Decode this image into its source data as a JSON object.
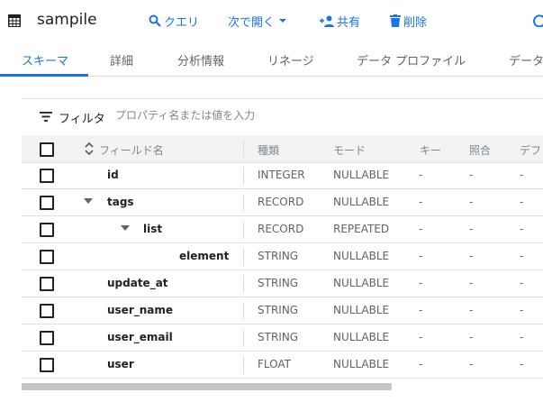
{
  "header": {
    "title": "sampile",
    "query_label": "クエリ",
    "open_label": "次で開く",
    "share_label": "共有",
    "delete_label": "削除"
  },
  "tabs": [
    "スキーマ",
    "詳細",
    "分析情報",
    "リネージ",
    "データ プロファイル",
    "データ"
  ],
  "filter": {
    "label": "フィルタ",
    "placeholder": "プロパティ名または値を入力"
  },
  "table": {
    "columns": [
      "フィールド名",
      "種類",
      "モード",
      "キー",
      "照合",
      "デフ"
    ],
    "rows": [
      {
        "name": "id",
        "type": "INTEGER",
        "mode": "NULLABLE",
        "key": "-",
        "collation": "-",
        "default": "-"
      },
      {
        "name": "tags",
        "type": "RECORD",
        "mode": "NULLABLE",
        "key": "-",
        "collation": "-",
        "default": "-"
      },
      {
        "name": "list",
        "type": "RECORD",
        "mode": "REPEATED",
        "key": "-",
        "collation": "-",
        "default": "-"
      },
      {
        "name": "element",
        "type": "STRING",
        "mode": "NULLABLE",
        "key": "-",
        "collation": "-",
        "default": "-"
      },
      {
        "name": "update_at",
        "type": "STRING",
        "mode": "NULLABLE",
        "key": "-",
        "collation": "-",
        "default": "-"
      },
      {
        "name": "user_name",
        "type": "STRING",
        "mode": "NULLABLE",
        "key": "-",
        "collation": "-",
        "default": "-"
      },
      {
        "name": "user_email",
        "type": "STRING",
        "mode": "NULLABLE",
        "key": "-",
        "collation": "-",
        "default": "-"
      },
      {
        "name": "user",
        "type": "FLOAT",
        "mode": "NULLABLE",
        "key": "-",
        "collation": "-",
        "default": "-"
      }
    ]
  },
  "colors": {
    "accent": "#1a73e8",
    "header_bg": "#f1f3f4",
    "border": "#e0e0e0"
  },
  "icons": [
    "table-icon",
    "search-icon",
    "dropdown-arrow-icon",
    "person-add-icon",
    "trash-icon",
    "refresh-icon",
    "filter-icon",
    "sort-icon",
    "caret-down-icon"
  ]
}
